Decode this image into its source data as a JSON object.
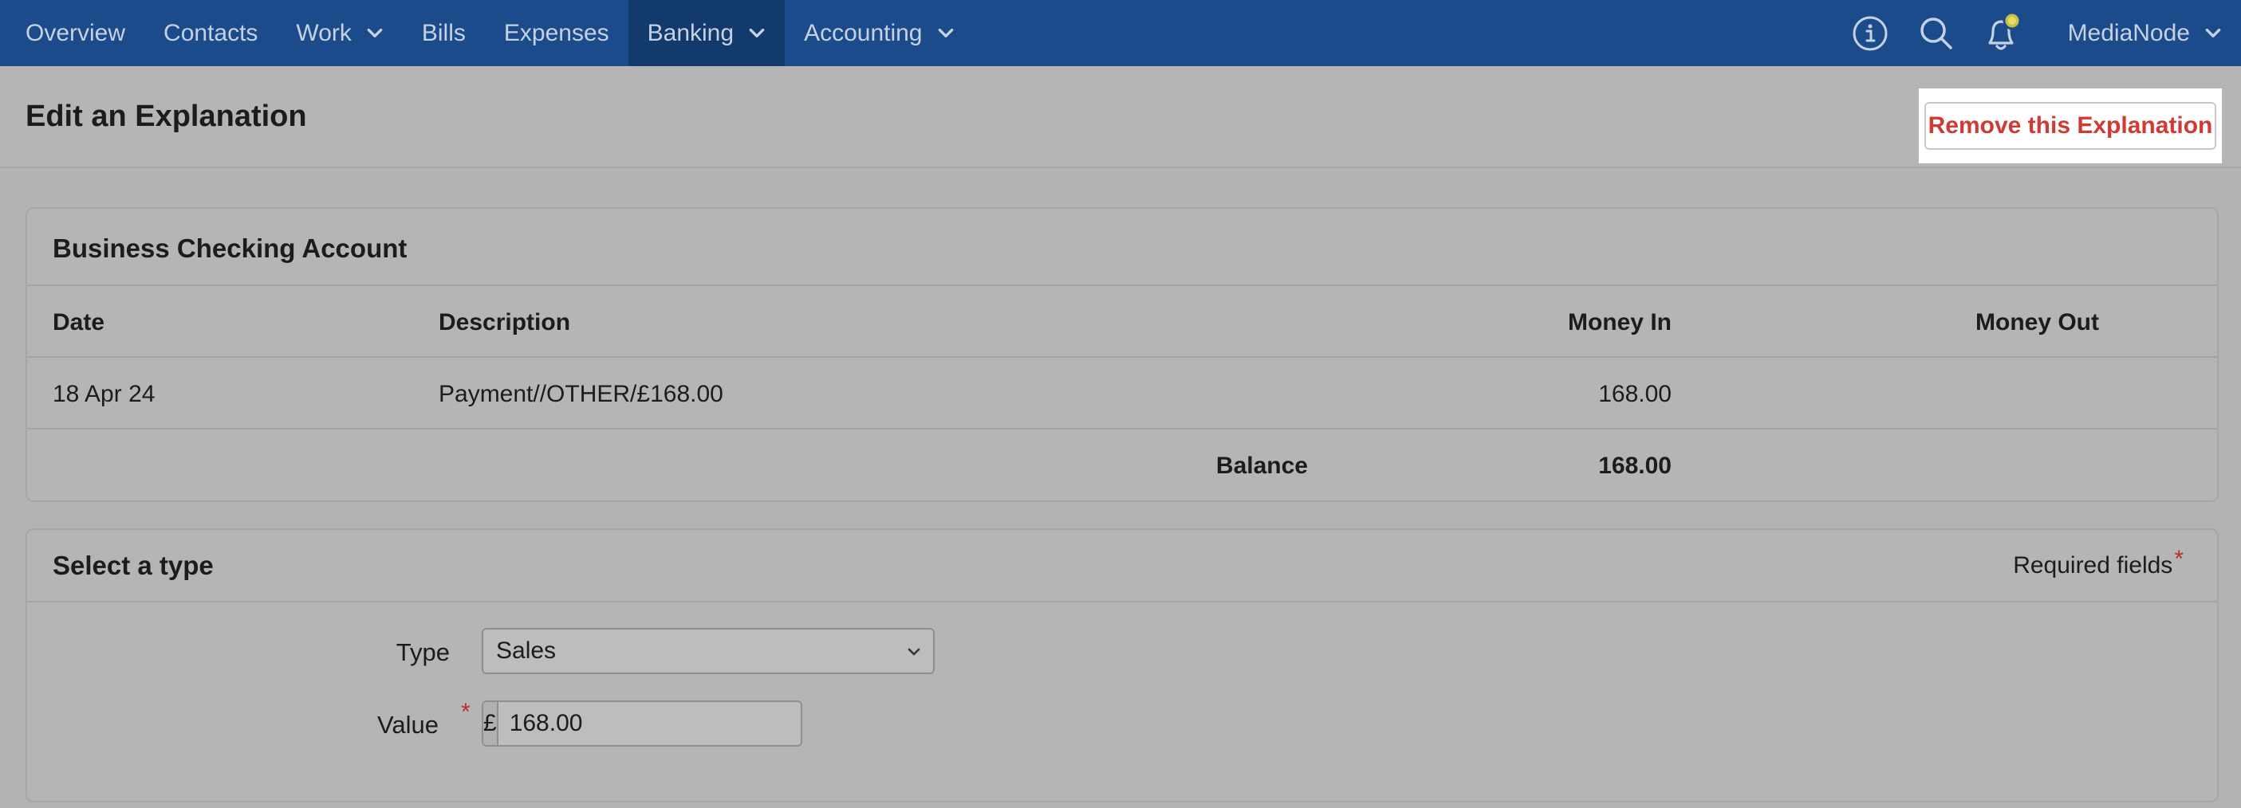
{
  "nav": {
    "items": [
      {
        "label": "Overview",
        "has_dropdown": false,
        "active": false
      },
      {
        "label": "Contacts",
        "has_dropdown": false,
        "active": false
      },
      {
        "label": "Work",
        "has_dropdown": true,
        "active": false
      },
      {
        "label": "Bills",
        "has_dropdown": false,
        "active": false
      },
      {
        "label": "Expenses",
        "has_dropdown": false,
        "active": false
      },
      {
        "label": "Banking",
        "has_dropdown": true,
        "active": true
      },
      {
        "label": "Accounting",
        "has_dropdown": true,
        "active": false
      }
    ],
    "icons": [
      "info-icon",
      "search-icon",
      "bell-icon"
    ],
    "user": "MediaNode"
  },
  "header": {
    "title": "Edit an Explanation",
    "remove_button": "Remove this Explanation"
  },
  "account": {
    "title": "Business Checking Account",
    "columns": {
      "date": "Date",
      "description": "Description",
      "money_in": "Money In",
      "money_out": "Money Out"
    },
    "rows": [
      {
        "date": "18 Apr 24",
        "description": "Payment//OTHER/£168.00",
        "money_in": "168.00",
        "money_out": ""
      }
    ],
    "balance_label": "Balance",
    "balance_value": "168.00"
  },
  "type_panel": {
    "title": "Select a type",
    "required_label": "Required fields",
    "required_star": "*",
    "type_label": "Type",
    "type_value": "Sales",
    "value_label": "Value",
    "value_star": "*",
    "currency_symbol": "£",
    "value": "168.00"
  },
  "colors": {
    "nav_bg": "#1b4b8a",
    "nav_active": "#123a6c",
    "danger": "#d03a33",
    "required": "#b3322b"
  }
}
